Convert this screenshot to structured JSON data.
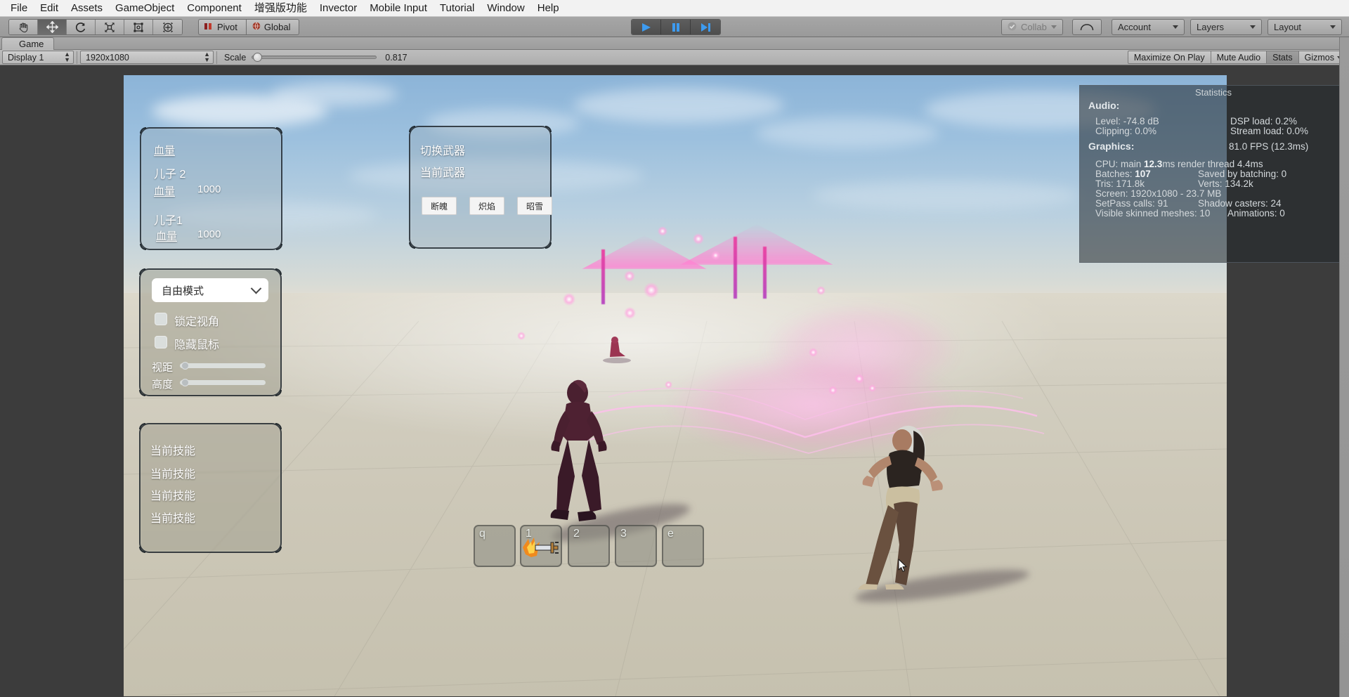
{
  "menu": {
    "items": [
      "File",
      "Edit",
      "Assets",
      "GameObject",
      "Component",
      "增强版功能",
      "Invector",
      "Mobile Input",
      "Tutorial",
      "Window",
      "Help"
    ]
  },
  "toolbar": {
    "tools": [
      {
        "name": "hand-tool",
        "icon": "hand"
      },
      {
        "name": "move-tool",
        "icon": "move"
      },
      {
        "name": "rotate-tool",
        "icon": "rotate"
      },
      {
        "name": "scale-tool",
        "icon": "scale"
      },
      {
        "name": "rect-tool",
        "icon": "rect"
      },
      {
        "name": "transform-tool",
        "icon": "transform"
      }
    ],
    "pivot_label": "Pivot",
    "global_label": "Global",
    "play_label": "Play",
    "pause_label": "Pause",
    "step_label": "Step",
    "collab_label": "Collab",
    "cloud_label": "Cloud",
    "account_label": "Account",
    "layers_label": "Layers",
    "layout_label": "Layout"
  },
  "game_tab": {
    "title": "Game"
  },
  "game_toolbar": {
    "display": "Display 1",
    "resolution": "1920x1080",
    "scale_label": "Scale",
    "scale_value": "0.817",
    "scale_fraction": 0.04,
    "maximize_on_play": "Maximize On Play",
    "mute_audio": "Mute Audio",
    "stats": "Stats",
    "gizmos": "Gizmos"
  },
  "statistics": {
    "title": "Statistics",
    "audio_header": "Audio:",
    "level": "Level: -74.8 dB",
    "dsp_load": "DSP load: 0.2%",
    "clipping": "Clipping: 0.0%",
    "stream_load": "Stream load: 0.0%",
    "graphics_header": "Graphics:",
    "fps": "81.0 FPS (12.3ms)",
    "cpu_prefix": "CPU: main ",
    "cpu_value": "12.3",
    "cpu_suffix": "ms  render thread 4.4ms",
    "batches_prefix": "Batches: ",
    "batches_value": "107",
    "saved_by_batching": "Saved by batching: 0",
    "tris": "Tris: 171.8k",
    "verts": "Verts: 134.2k",
    "screen": "Screen: 1920x1080 - 23.7 MB",
    "setpass": "SetPass calls: 91",
    "shadow_casters": "Shadow casters: 24",
    "visible_skinned_meshes": "Visible skinned meshes: 10",
    "animations": "Animations: 0"
  },
  "hud": {
    "health_panel": {
      "title": "血量",
      "entries": [
        {
          "name": "儿子 2",
          "label": "血量",
          "value": "1000"
        },
        {
          "name": "儿子1",
          "label": "血量",
          "value": "1000"
        }
      ]
    },
    "weapon_panel": {
      "title": "切换武器",
      "current_label": "当前武器",
      "buttons": [
        "断魄",
        "炽焰",
        "昭雪"
      ]
    },
    "camera_panel": {
      "mode": "自由模式",
      "lock_view_label": "锁定视角",
      "hide_cursor_label": "隐藏鼠标",
      "distance_label": "视距",
      "height_label": "高度",
      "distance_value": 0.02,
      "height_value": 0.02
    },
    "skills_panel": {
      "items": [
        "当前技能",
        "当前技能",
        "当前技能",
        "当前技能"
      ]
    },
    "hotbar": {
      "slots": [
        {
          "key": "q",
          "icon": ""
        },
        {
          "key": "1",
          "icon": "flame-sword-icon"
        },
        {
          "key": "2",
          "icon": ""
        },
        {
          "key": "3",
          "icon": ""
        },
        {
          "key": "e",
          "icon": ""
        }
      ]
    }
  },
  "colors": {
    "menubar_bg": "#f2f2f2",
    "toolbar_bg": "#a0a0a0",
    "play_blue": "#3d9bf0",
    "game_sky": "#9cc0de",
    "game_ground": "#cdc8b8",
    "fx_pink": "#ec40a0",
    "stats_bg": "#20262a"
  }
}
